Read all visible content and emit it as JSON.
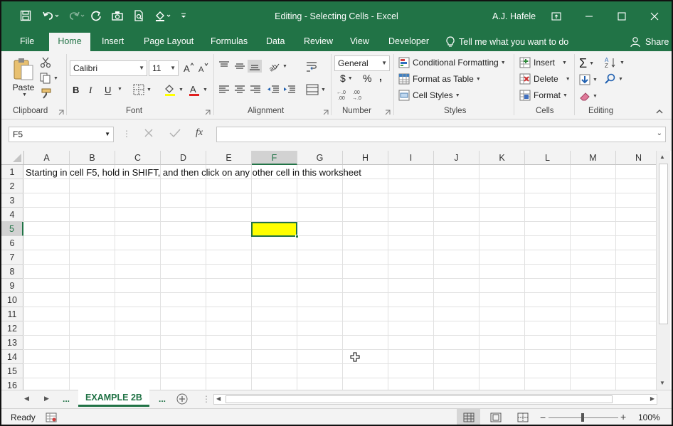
{
  "window": {
    "title": "Editing - Selecting Cells  -  Excel",
    "user": "A.J. Hafele"
  },
  "ribbon_tabs": [
    "File",
    "Home",
    "Insert",
    "Page Layout",
    "Formulas",
    "Data",
    "Review",
    "View",
    "Developer"
  ],
  "tell_me": "Tell me what you want to do",
  "share": "Share",
  "clipboard": {
    "paste": "Paste",
    "label": "Clipboard"
  },
  "font": {
    "name": "Calibri",
    "size": "11",
    "bold": "B",
    "italic": "I",
    "underline": "U",
    "label": "Font"
  },
  "alignment": {
    "label": "Alignment"
  },
  "number": {
    "format": "General",
    "currency": "$",
    "percent": "%",
    "comma": ",",
    "label": "Number"
  },
  "styles": {
    "conditional": "Conditional Formatting",
    "format_table": "Format as Table",
    "cell_styles": "Cell Styles",
    "label": "Styles"
  },
  "cells": {
    "insert": "Insert",
    "delete": "Delete",
    "format": "Format",
    "label": "Cells"
  },
  "editing": {
    "label": "Editing"
  },
  "formula_bar": {
    "name_box": "F5",
    "fx": "fx",
    "formula": ""
  },
  "columns": [
    "A",
    "B",
    "C",
    "D",
    "E",
    "F",
    "G",
    "H",
    "I",
    "J",
    "K",
    "L",
    "M",
    "N"
  ],
  "rows": [
    "1",
    "2",
    "3",
    "4",
    "5",
    "6",
    "7",
    "8",
    "9",
    "10",
    "11",
    "12",
    "13",
    "14",
    "15",
    "16"
  ],
  "cell_A1": "Starting in cell F5, hold in SHIFT, and then click on any other cell in this worksheet",
  "selected_cell": {
    "address": "F5",
    "fill": "#ffff00"
  },
  "sheet_tabs": {
    "active": "EXAMPLE 2B",
    "more_left": "...",
    "more_right": "..."
  },
  "status": {
    "ready": "Ready",
    "zoom": "100%"
  },
  "colors": {
    "accent": "#217346"
  }
}
